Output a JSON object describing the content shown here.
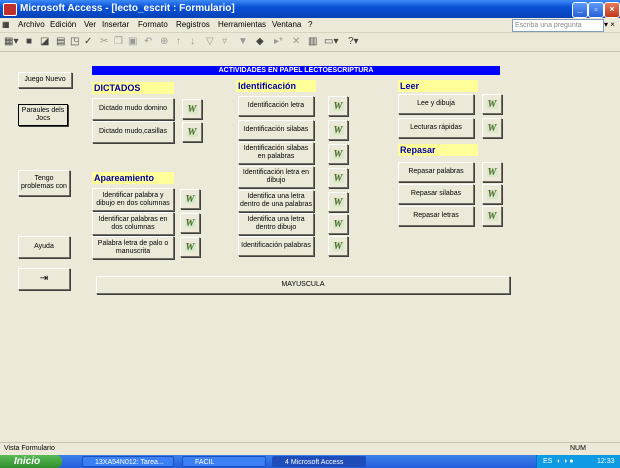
{
  "window": {
    "title": "Microsoft Access - [lecto_escrit : Formulario]"
  },
  "menus": [
    "Archivo",
    "Edición",
    "Ver",
    "Insertar",
    "Formato",
    "Registros",
    "Herramientas",
    "Ventana",
    "?"
  ],
  "help_placeholder": "Escriba una pregunta",
  "banner": "ACTIVIDADES EN PAPEL LECTOESCRIPTURA",
  "left_buttons": {
    "juego_nuevo": "Juego Nuevo",
    "parauls": "Paraules dels Jocs",
    "tengo": "Tengo problemas con",
    "ayuda": "Ayuda"
  },
  "dictados": {
    "title": "DICTADOS",
    "items": [
      "Dictado mudo domino",
      "Dictado mudo,casillas"
    ]
  },
  "apareamiento": {
    "title": "Apareamiento",
    "items": [
      "Identificar palabra y dibujo en dos columnas",
      "Identificar palabras  en dos columnas",
      "Palabra letra de palo o manuscrita"
    ]
  },
  "identificacion": {
    "title": "Identificación",
    "items": [
      "Identificación letra",
      "Identificación silabas",
      "Identificación silabas en palabras",
      "Identificación letra en dibujo",
      "Identifica una letra dentro de una palabras",
      "Identifica una letra dentro dibujo",
      "Identificación palabras"
    ]
  },
  "leer": {
    "title": "Leer",
    "items": [
      "Lee y dibuja",
      "Lecturas rápidas"
    ]
  },
  "repasar": {
    "title": "Repasar",
    "items": [
      "Repasar palabras",
      "Repasar silabas",
      "Repasar letras"
    ]
  },
  "mayuscula": "MAYUSCULA",
  "word_icon_letter": "W",
  "status": {
    "left": "Vista Formulario",
    "right": "NUM"
  },
  "taskbar": {
    "start": "Inicio",
    "tasks": [
      "13XA54N012: Tarea...",
      "FACIL",
      "4 Microsoft Access"
    ],
    "tray_lang": "ES",
    "clock": "12:33"
  },
  "colors": {
    "titlebar": "#0a52d6",
    "banner": "#0000ff",
    "section_bg": "#ffff99",
    "section_text": "#0000a8"
  }
}
